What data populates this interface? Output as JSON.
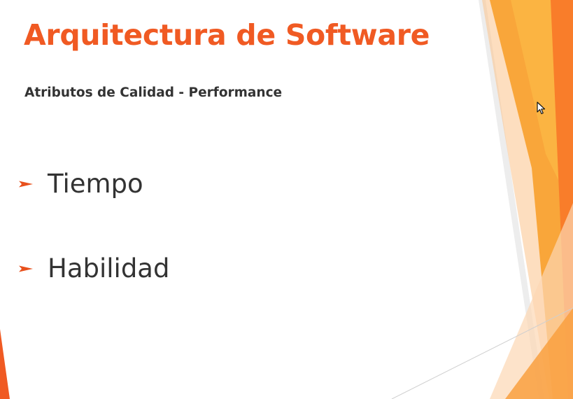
{
  "slide": {
    "title": "Arquitectura de Software",
    "subtitle": "Atributos de Calidad - Performance",
    "bullets": [
      {
        "label": "Tiempo",
        "icon": "arrow-right-icon"
      },
      {
        "label": "Habilidad",
        "icon": "arrow-right-icon"
      }
    ]
  },
  "colors": {
    "accent": "#f05a23",
    "accent_dark": "#e8501c",
    "orange_bright": "#f97d2a",
    "amber": "#f9a63a",
    "yellow": "#fbb845",
    "text": "#333333",
    "background": "#ffffff"
  },
  "icons": {
    "bullet": "arrow-right-icon",
    "cursor": "mouse-pointer-icon"
  }
}
